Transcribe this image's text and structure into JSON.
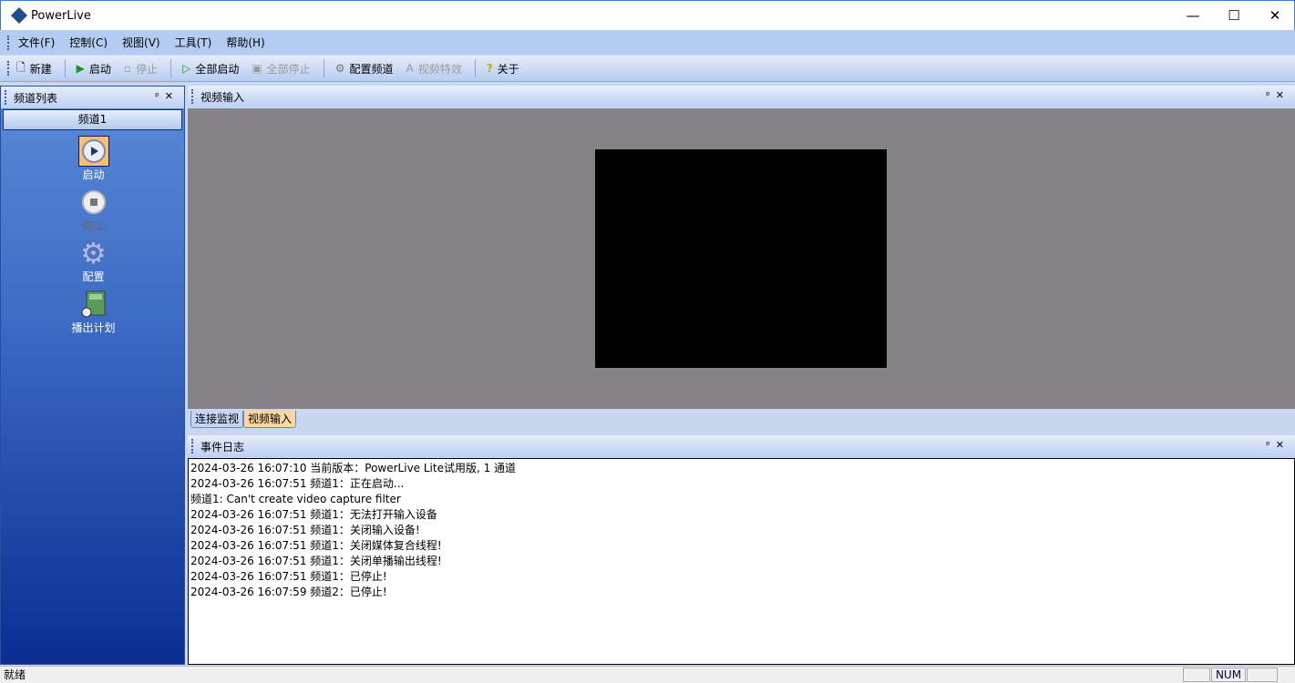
{
  "window": {
    "title": "PowerLive",
    "minimize": "—",
    "maximize": "☐",
    "close": "✕"
  },
  "menu": [
    "文件(F)",
    "控制(C)",
    "视图(V)",
    "工具(T)",
    "帮助(H)"
  ],
  "toolbar": {
    "new": "新建",
    "start": "启动",
    "stop": "停止",
    "start_all": "全部启动",
    "stop_all": "全部停止",
    "config_channel": "配置频道",
    "video_effects": "视频特效",
    "about": "关于"
  },
  "channel_panel": {
    "title": "频道列表",
    "channel": "频道1",
    "items": [
      {
        "label": "启动",
        "icon": "play-icon"
      },
      {
        "label": "停止",
        "icon": "stop-icon"
      },
      {
        "label": "配置",
        "icon": "gear-icon"
      },
      {
        "label": "播出计划",
        "icon": "schedule-icon"
      }
    ]
  },
  "video_panel": {
    "title": "视频输入",
    "tabs": [
      "连接监视",
      "视频输入"
    ],
    "active_tab": 1
  },
  "log_panel": {
    "title": "事件日志",
    "lines": [
      "2024-03-26 16:07:10 当前版本：PowerLive Lite试用版, 1 通道",
      "2024-03-26 16:07:51 频道1：正在启动...",
      "频道1: Can't create video capture filter",
      "2024-03-26 16:07:51 频道1：无法打开输入设备",
      "2024-03-26 16:07:51 频道1：关闭输入设备!",
      "2024-03-26 16:07:51 频道1：关闭媒体复合线程!",
      "2024-03-26 16:07:51 频道1：关闭单播输出线程!",
      "2024-03-26 16:07:51 频道1：已停止!",
      "2024-03-26 16:07:59 频道2：已停止!"
    ]
  },
  "status": {
    "text": "就绪",
    "num": "NUM"
  },
  "panel_buttons": {
    "pin": "ᵖ",
    "close": "✕"
  }
}
